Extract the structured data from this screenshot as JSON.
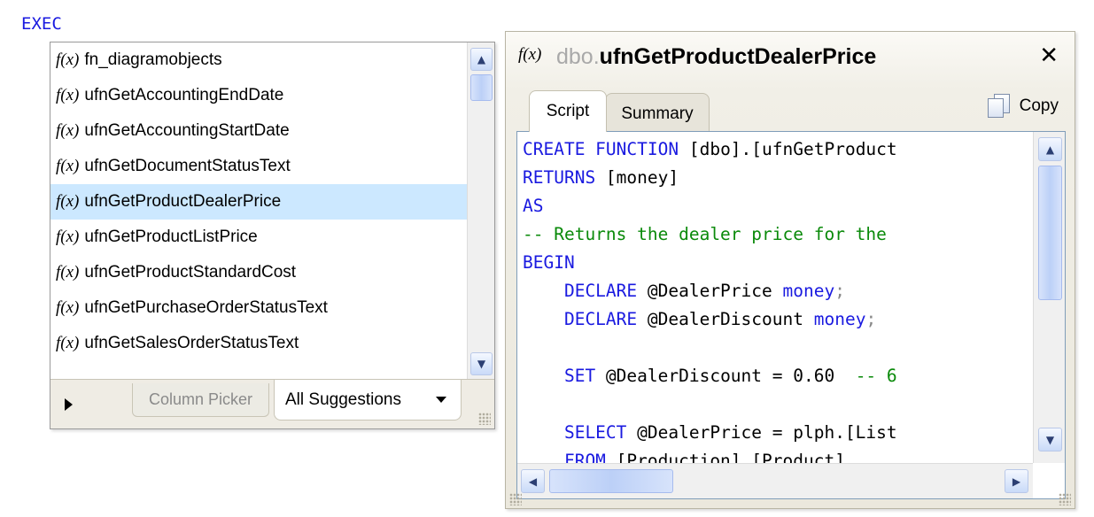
{
  "exec_keyword": "EXEC",
  "suggestions": {
    "fx_label": "f(x)",
    "items": [
      {
        "name": "fn_diagramobjects",
        "selected": false
      },
      {
        "name": "ufnGetAccountingEndDate",
        "selected": false
      },
      {
        "name": "ufnGetAccountingStartDate",
        "selected": false
      },
      {
        "name": "ufnGetDocumentStatusText",
        "selected": false
      },
      {
        "name": "ufnGetProductDealerPrice",
        "selected": true
      },
      {
        "name": "ufnGetProductListPrice",
        "selected": false
      },
      {
        "name": "ufnGetProductStandardCost",
        "selected": false
      },
      {
        "name": "ufnGetPurchaseOrderStatusText",
        "selected": false
      },
      {
        "name": "ufnGetSalesOrderStatusText",
        "selected": false
      }
    ],
    "footer": {
      "tab_column_picker": "Column Picker",
      "tab_all_suggestions": "All Suggestions"
    },
    "selected_color": "#cce8ff"
  },
  "preview": {
    "fx_label": "f(x)",
    "schema": "dbo.",
    "function_name": "ufnGetProductDealerPrice",
    "close_glyph": "✕",
    "tabs": {
      "script": "Script",
      "summary": "Summary"
    },
    "copy_label": "Copy",
    "code_lines": [
      [
        {
          "t": "CREATE FUNCTION",
          "c": "kw"
        },
        {
          "t": " [dbo].[ufnGetProduct",
          "c": "tx"
        }
      ],
      [
        {
          "t": "RETURNS",
          "c": "kw"
        },
        {
          "t": " [money]",
          "c": "tx"
        }
      ],
      [
        {
          "t": "AS",
          "c": "kw"
        }
      ],
      [
        {
          "t": "-- Returns the dealer price for the",
          "c": "cm"
        }
      ],
      [
        {
          "t": "BEGIN",
          "c": "kw"
        }
      ],
      [
        {
          "t": "    DECLARE",
          "c": "kw"
        },
        {
          "t": " @DealerPrice ",
          "c": "tx"
        },
        {
          "t": "money",
          "c": "kw"
        },
        {
          "t": ";",
          "c": "gy"
        }
      ],
      [
        {
          "t": "    DECLARE",
          "c": "kw"
        },
        {
          "t": " @DealerDiscount ",
          "c": "tx"
        },
        {
          "t": "money",
          "c": "kw"
        },
        {
          "t": ";",
          "c": "gy"
        }
      ],
      [
        {
          "t": "",
          "c": "tx"
        }
      ],
      [
        {
          "t": "    SET",
          "c": "kw"
        },
        {
          "t": " @DealerDiscount = 0.60  ",
          "c": "tx"
        },
        {
          "t": "-- 6",
          "c": "cm"
        }
      ],
      [
        {
          "t": "",
          "c": "tx"
        }
      ],
      [
        {
          "t": "    SELECT",
          "c": "kw"
        },
        {
          "t": " @DealerPrice = plph.[List",
          "c": "tx"
        }
      ],
      [
        {
          "t": "    FROM",
          "c": "kw"
        },
        {
          "t": " [Production].[Product]",
          "c": "tx"
        }
      ]
    ],
    "colors": {
      "keyword": "#1a1ae0",
      "comment": "#0a8a0a",
      "text": "#000000"
    }
  }
}
